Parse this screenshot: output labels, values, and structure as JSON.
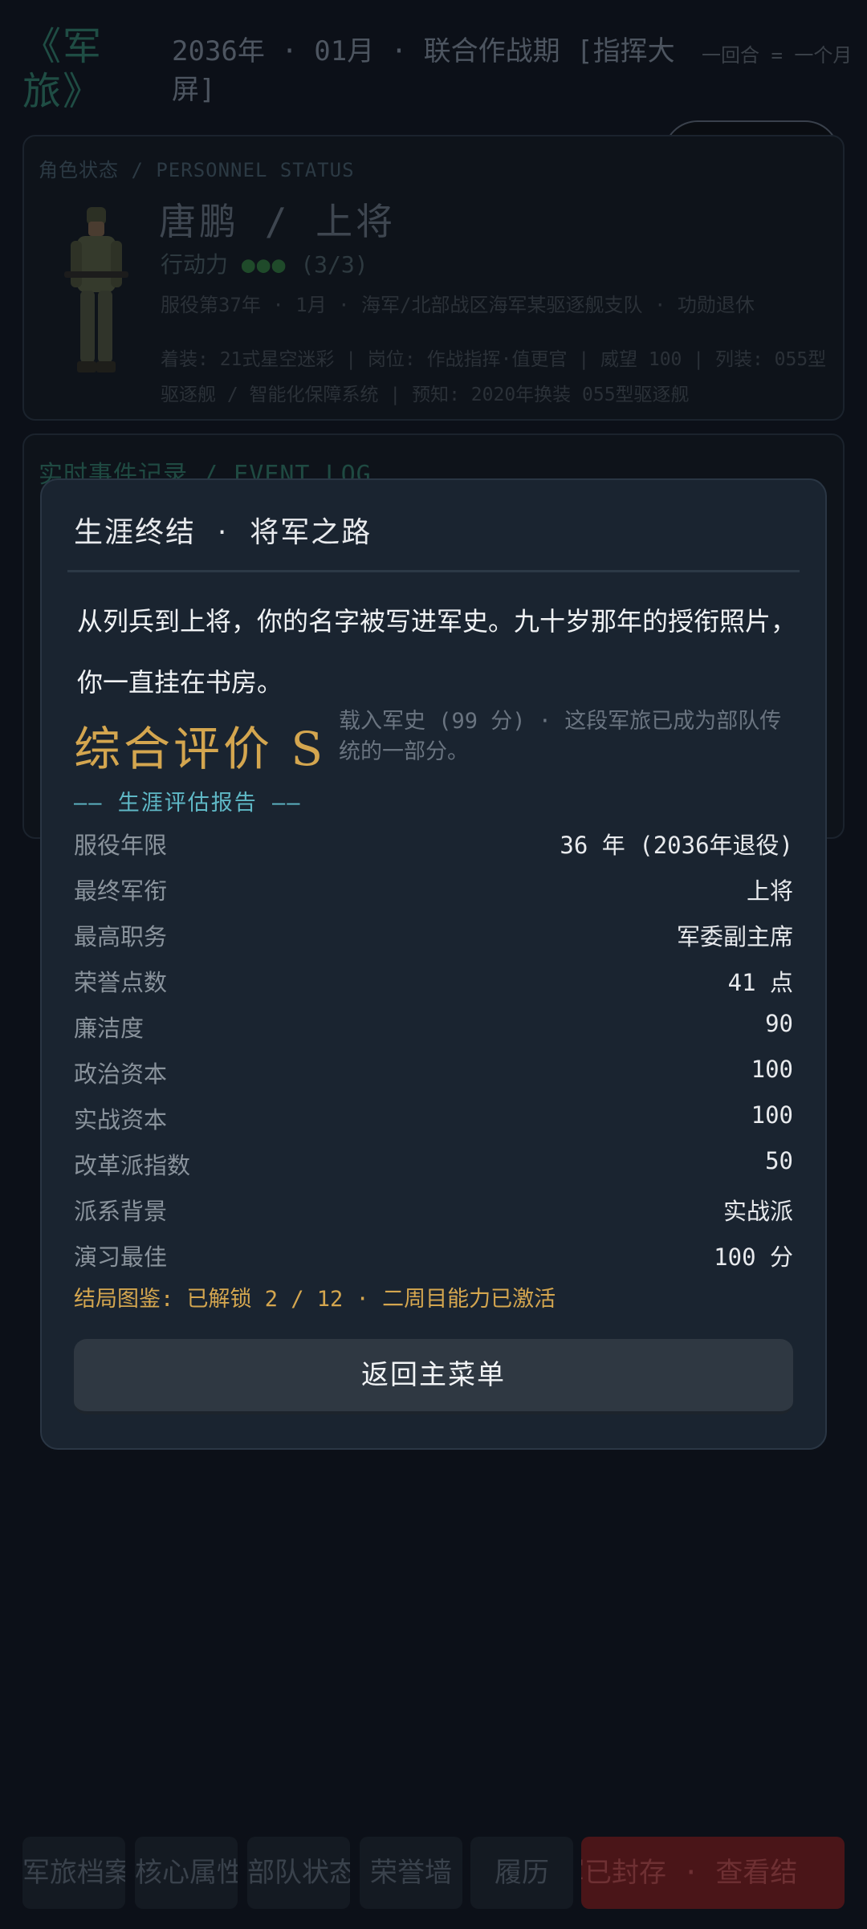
{
  "header": {
    "logo": "《军旅》",
    "date_title": "2036年 · 01月 · 联合作战期 [指挥大屏]",
    "turn_note": "一回合 = 一个月"
  },
  "status_panel": {
    "label": "角色状态 / PERSONNEL STATUS",
    "name_rank": "唐鹏  /  上将",
    "action_label": "行动力",
    "action_pips": "●●●",
    "action_count": "(3/3)",
    "service_line": "服役第37年 · 1月 · 海军/北部战区海军某驱逐舰支队 · 功勋退休",
    "gear_line": "着装: 21式星空迷彩 | 岗位: 作战指挥·值更官 | 威望 100 | 列装: 055型驱逐舰 / 智能化保障系统 | 预知: 2020年换装 055型驱逐舰"
  },
  "events_panel": {
    "label": "实时事件记录 / EVENT LOG"
  },
  "bottom_tabs": [
    "军旅档案",
    "核心属性",
    "部队状态",
    "荣誉墙",
    "履历",
    "军已封存 · 查看结"
  ],
  "modal": {
    "title": "生涯终结  ·  将军之路",
    "story": "从列兵到上将，你的名字被写进军史。九十岁那年的授衔照片，你一直挂在书房。",
    "grade_label": "综合评价 S",
    "grade_note": "载入军史 (99 分) · 这段军旅已成为部队传统的一部分。",
    "report_header": "—— 生涯评估报告 ——",
    "stats": [
      {
        "key": "服役年限",
        "value": "36 年 (2036年退役)"
      },
      {
        "key": "最终军衔",
        "value": "上将"
      },
      {
        "key": "最高职务",
        "value": "军委副主席"
      },
      {
        "key": "荣誉点数",
        "value": "41 点"
      },
      {
        "key": "廉洁度",
        "value": "90"
      },
      {
        "key": "政治资本",
        "value": "100"
      },
      {
        "key": "实战资本",
        "value": "100"
      },
      {
        "key": "改革派指数",
        "value": "50"
      },
      {
        "key": "派系背景",
        "value": "实战派"
      },
      {
        "key": "演习最佳",
        "value": "100 分"
      }
    ],
    "endings_line": "结局图鉴: 已解锁 2 / 12 · 二周目能力已激活",
    "back_button": "返回主菜单"
  },
  "colors": {
    "accent_gold": "#d4a64f",
    "accent_cyan": "#5fb8c6",
    "modal_bg": "#1a2430",
    "danger_tab": "#4a1518"
  }
}
